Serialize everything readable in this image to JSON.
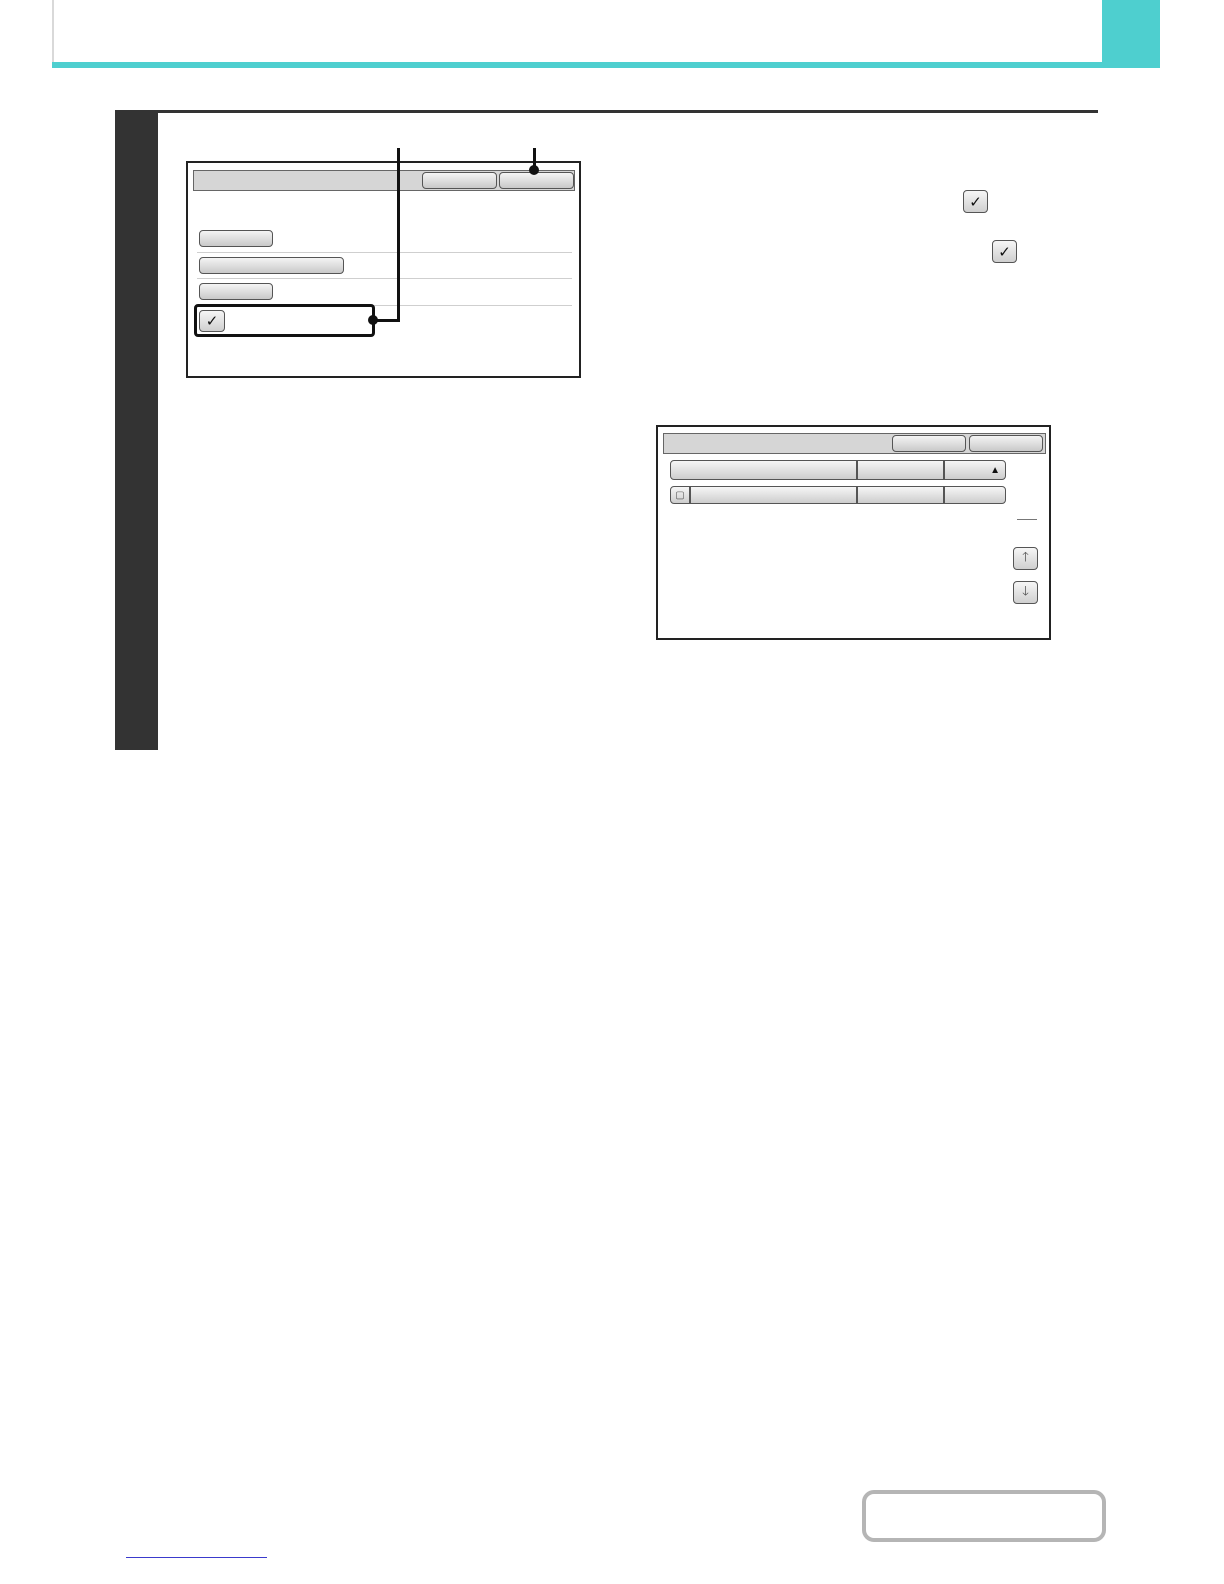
{
  "colors": {
    "header_accent": "#4ecfcf",
    "step_sidebar": "#333333",
    "contents_button_border": "#b5b5b5",
    "link_underline": "#3a3acc"
  },
  "icons": {
    "checkmark": "✓",
    "sort_indicator": "▲",
    "scroll_up": "🡑",
    "scroll_down": "🡓",
    "row_item": "▢"
  }
}
